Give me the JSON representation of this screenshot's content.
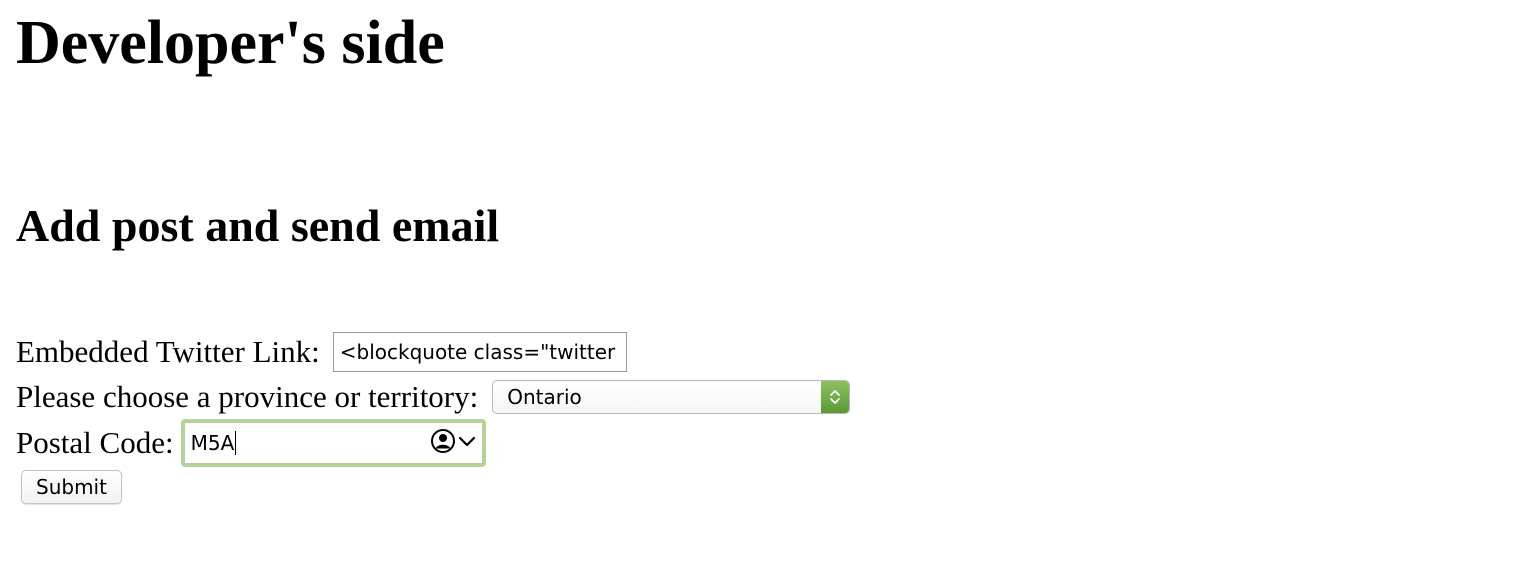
{
  "header": {
    "title": "Developer's side"
  },
  "form": {
    "heading": "Add post and send email",
    "twitter_link": {
      "label": "Embedded Twitter Link:",
      "value": "<blockquote class=\"twitter"
    },
    "province": {
      "label": "Please choose a province or territory:",
      "selected": "Ontario"
    },
    "postal_code": {
      "label": "Postal Code:",
      "value": "M5A"
    },
    "submit_label": "Submit"
  },
  "colors": {
    "focus_ring": "#b3d39b",
    "stepper_accent": "#6aab45"
  },
  "icons": {
    "select_stepper": "up-down-chevron-icon",
    "autofill_contact": "person-circle-icon",
    "autofill_dropdown": "chevron-down-icon"
  }
}
